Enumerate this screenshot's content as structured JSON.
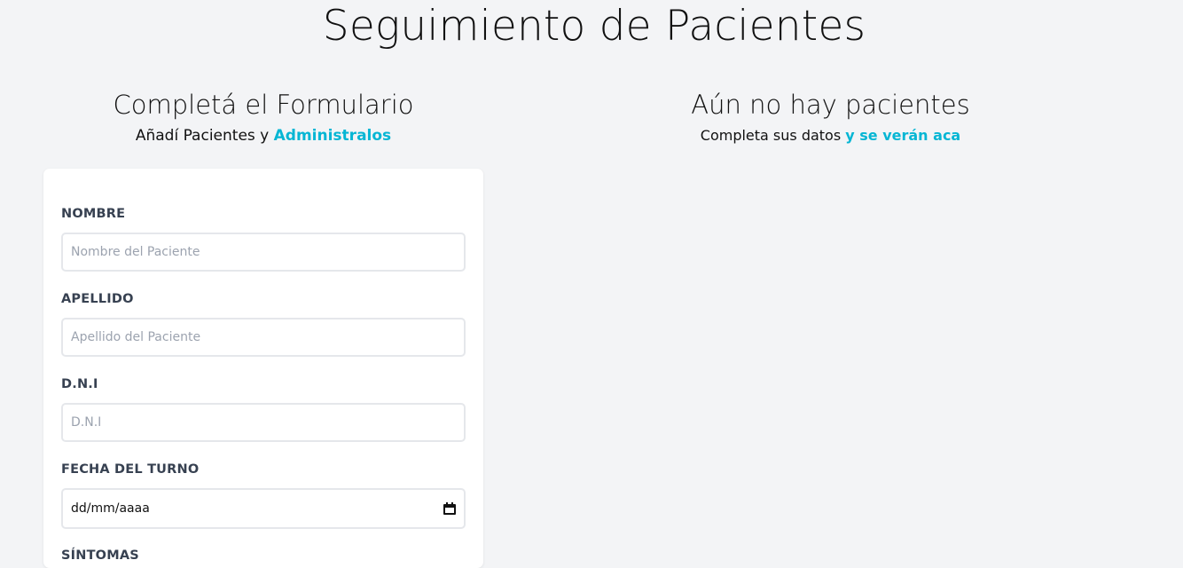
{
  "header": {
    "title": "Seguimiento de Pacientes"
  },
  "form_section": {
    "heading": "Completá el Formulario",
    "subtitle_prefix": "Añadí Pacientes y ",
    "subtitle_accent": "Administralos"
  },
  "list_section": {
    "heading": "Aún no hay pacientes",
    "subtitle_prefix": "Completa sus datos ",
    "subtitle_accent": "y se verán aca"
  },
  "form": {
    "nombre_label": "NOMBRE",
    "nombre_placeholder": "Nombre del Paciente",
    "apellido_label": "APELLIDO",
    "apellido_placeholder": "Apellido del Paciente",
    "dni_label": "D.N.I",
    "dni_placeholder": "D.N.I",
    "fecha_label": "FECHA DEL TURNO",
    "fecha_value": "dd/mm/aaaa",
    "sintomas_label": "SÍNTOMAS"
  },
  "colors": {
    "accent": "#06b6d4",
    "background": "#f3f4f6",
    "card": "#ffffff",
    "label": "#374151"
  }
}
